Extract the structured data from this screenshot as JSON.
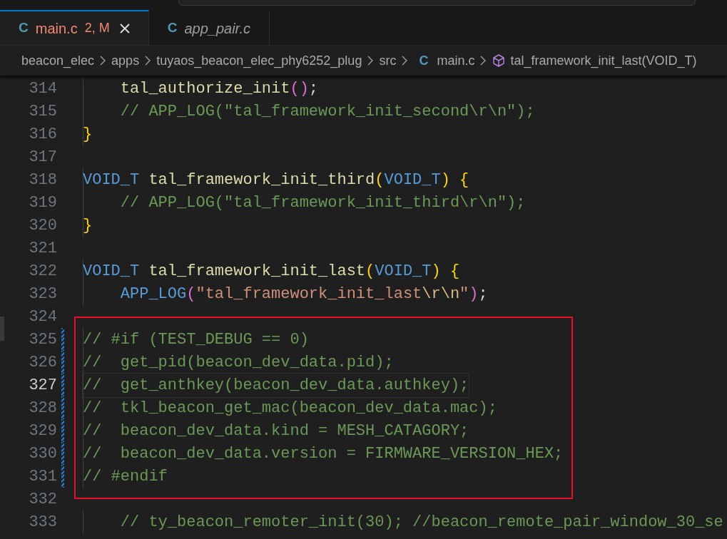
{
  "tabs": [
    {
      "icon": "C",
      "label": "main.c",
      "badge": "2, M",
      "selected": true,
      "preview": false
    },
    {
      "icon": "C",
      "label": "app_pair.c",
      "selected": false,
      "preview": true
    }
  ],
  "breadcrumb": [
    {
      "label": "beacon_elec",
      "kind": "folder"
    },
    {
      "label": "apps",
      "kind": "folder"
    },
    {
      "label": "tuyaos_beacon_elec_phy6252_plug",
      "kind": "folder"
    },
    {
      "label": "src",
      "kind": "folder"
    },
    {
      "icon": "C",
      "label": "main.c",
      "kind": "file"
    },
    {
      "label": "tal_framework_init_last(VOID_T)",
      "kind": "symbol"
    }
  ],
  "lines": [
    {
      "number": "314",
      "tokens": [
        {
          "text": "    tal_authorize_init",
          "kind": "function"
        },
        {
          "text": "()",
          "kind": "bracket2"
        },
        {
          "text": ";",
          "kind": "plain"
        }
      ]
    },
    {
      "number": "315",
      "tokens": [
        {
          "text": "    // APP_LOG(\"tal_framework_init_second\\r\\n\");",
          "kind": "comment"
        }
      ]
    },
    {
      "number": "316",
      "tokens": [
        {
          "text": "}",
          "kind": "bracket1"
        }
      ]
    },
    {
      "number": "317"
    },
    {
      "number": "318",
      "tokens": [
        {
          "text": "VOID_T",
          "kind": "keyword"
        },
        {
          "text": " tal_framework_init_third",
          "kind": "function"
        },
        {
          "text": "(",
          "kind": "bracket1"
        },
        {
          "text": "VOID_T",
          "kind": "keyword"
        },
        {
          "text": ") {",
          "kind": "bracket1"
        }
      ]
    },
    {
      "number": "319",
      "tokens": [
        {
          "text": "    // APP_LOG(\"tal_framework_init_third\\r\\n\");",
          "kind": "comment"
        }
      ]
    },
    {
      "number": "320",
      "tokens": [
        {
          "text": "}",
          "kind": "bracket1"
        }
      ]
    },
    {
      "number": "321"
    },
    {
      "number": "322",
      "tokens": [
        {
          "text": "VOID_T",
          "kind": "keyword"
        },
        {
          "text": " tal_framework_init_last",
          "kind": "function"
        },
        {
          "text": "(",
          "kind": "bracket1"
        },
        {
          "text": "VOID_T",
          "kind": "keyword"
        },
        {
          "text": ") {",
          "kind": "bracket1"
        }
      ]
    },
    {
      "number": "323",
      "tokens": [
        {
          "text": "    APP_LOG",
          "kind": "keyword"
        },
        {
          "text": "(",
          "kind": "bracket2"
        },
        {
          "text": "\"tal_framework_init_last",
          "kind": "string"
        },
        {
          "text": "\\r\\n",
          "kind": "escape"
        },
        {
          "text": "\"",
          "kind": "string"
        },
        {
          "text": ")",
          "kind": "bracket2"
        },
        {
          "text": ";",
          "kind": "plain"
        }
      ]
    },
    {
      "number": "324"
    },
    {
      "number": "325",
      "modified": true,
      "annotated": true,
      "tokens": [
        {
          "text": "// #if (TEST_DEBUG == 0)",
          "kind": "comment"
        }
      ]
    },
    {
      "number": "326",
      "modified": true,
      "annotated": true,
      "tokens": [
        {
          "text": "//  get_pid(beacon_dev_data.pid);",
          "kind": "comment"
        }
      ]
    },
    {
      "number": "327",
      "modified": true,
      "annotated": true,
      "current": true,
      "tokens": [
        {
          "text": "//  get_anthkey(beacon_dev_data.authkey);",
          "kind": "comment"
        }
      ]
    },
    {
      "number": "328",
      "modified": true,
      "annotated": true,
      "tokens": [
        {
          "text": "//  tkl_beacon_get_mac(beacon_dev_data.mac);",
          "kind": "comment"
        }
      ]
    },
    {
      "number": "329",
      "modified": true,
      "annotated": true,
      "tokens": [
        {
          "text": "//  beacon_dev_data.kind = MESH_CATAGORY;",
          "kind": "comment"
        }
      ]
    },
    {
      "number": "330",
      "modified": true,
      "annotated": true,
      "tokens": [
        {
          "text": "//  beacon_dev_data.version = FIRMWARE_VERSION_HEX;",
          "kind": "comment"
        }
      ]
    },
    {
      "number": "331",
      "modified": true,
      "annotated": true,
      "tokens": [
        {
          "text": "// #endif",
          "kind": "comment"
        }
      ]
    },
    {
      "number": "332"
    },
    {
      "number": "333",
      "tokens": [
        {
          "text": "    // ty_beacon_remoter_init(30); //beacon_remote_pair_window_30_se",
          "kind": "comment"
        }
      ]
    }
  ]
}
